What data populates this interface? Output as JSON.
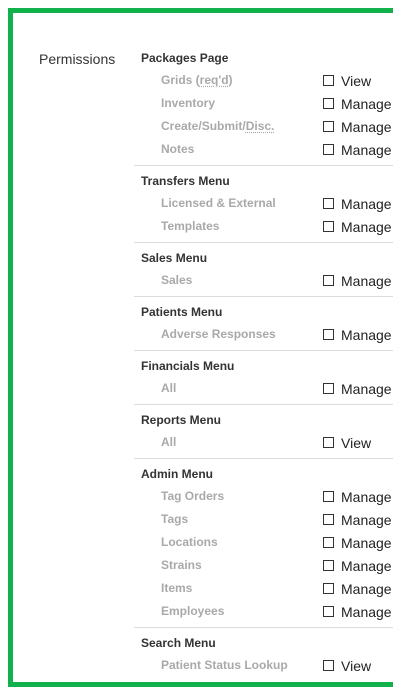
{
  "permissions_label": "Permissions",
  "sections": [
    {
      "id": "packages-page",
      "title": "Packages Page",
      "rows": [
        {
          "id": "grids",
          "pre": "Grids (",
          "abbr": "req'd",
          "post": ")",
          "option": "View"
        },
        {
          "id": "inventory",
          "pre": "Inventory",
          "abbr": "",
          "post": "",
          "option": "Manage"
        },
        {
          "id": "create-submit-disc",
          "pre": "Create/Submit/",
          "abbr": "Disc.",
          "post": "",
          "option": "Manage"
        },
        {
          "id": "notes",
          "pre": "Notes",
          "abbr": "",
          "post": "",
          "option": "Manage"
        }
      ]
    },
    {
      "id": "transfers-menu",
      "title": "Transfers Menu",
      "rows": [
        {
          "id": "licensed-external",
          "pre": "Licensed & External",
          "abbr": "",
          "post": "",
          "option": "Manage"
        },
        {
          "id": "templates",
          "pre": "Templates",
          "abbr": "",
          "post": "",
          "option": "Manage"
        }
      ]
    },
    {
      "id": "sales-menu",
      "title": "Sales Menu",
      "rows": [
        {
          "id": "sales",
          "pre": "Sales",
          "abbr": "",
          "post": "",
          "option": "Manage"
        }
      ]
    },
    {
      "id": "patients-menu",
      "title": "Patients Menu",
      "rows": [
        {
          "id": "adverse-responses",
          "pre": "Adverse Responses",
          "abbr": "",
          "post": "",
          "option": "Manage"
        }
      ]
    },
    {
      "id": "financials-menu",
      "title": "Financials Menu",
      "rows": [
        {
          "id": "financials-all",
          "pre": "All",
          "abbr": "",
          "post": "",
          "option": "Manage"
        }
      ]
    },
    {
      "id": "reports-menu",
      "title": "Reports Menu",
      "rows": [
        {
          "id": "reports-all",
          "pre": "All",
          "abbr": "",
          "post": "",
          "option": "View"
        }
      ]
    },
    {
      "id": "admin-menu",
      "title": "Admin Menu",
      "rows": [
        {
          "id": "tag-orders",
          "pre": "Tag Orders",
          "abbr": "",
          "post": "",
          "option": "Manage"
        },
        {
          "id": "tags",
          "pre": "Tags",
          "abbr": "",
          "post": "",
          "option": "Manage"
        },
        {
          "id": "locations",
          "pre": "Locations",
          "abbr": "",
          "post": "",
          "option": "Manage"
        },
        {
          "id": "strains",
          "pre": "Strains",
          "abbr": "",
          "post": "",
          "option": "Manage"
        },
        {
          "id": "items",
          "pre": "Items",
          "abbr": "",
          "post": "",
          "option": "Manage"
        },
        {
          "id": "employees",
          "pre": "Employees",
          "abbr": "",
          "post": "",
          "option": "Manage"
        }
      ]
    },
    {
      "id": "search-menu",
      "title": "Search Menu",
      "rows": [
        {
          "id": "patient-status-lookup",
          "pre": "Patient Status Lookup",
          "abbr": "",
          "post": "",
          "option": "View"
        }
      ]
    }
  ],
  "colors": {
    "frame_border": "#11b14c",
    "section_title": "#333333",
    "row_label": "#a9a9a9",
    "divider": "#dcdcdc"
  }
}
